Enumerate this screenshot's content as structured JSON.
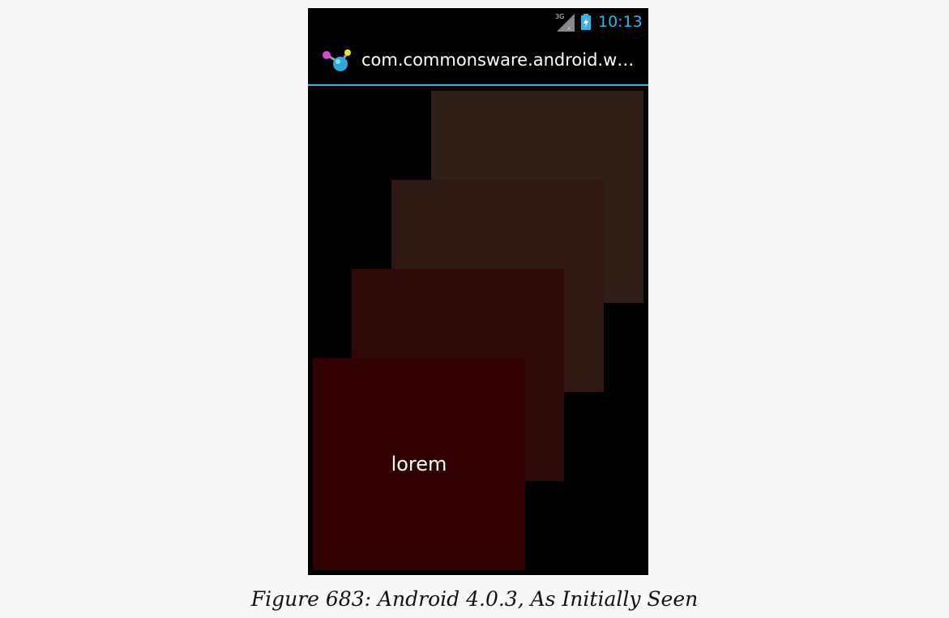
{
  "status_bar": {
    "network_label": "3G",
    "time": "10:13",
    "signal_icon": "signal-icon",
    "battery_icon": "battery-charging-icon",
    "accent_color": "#33b5e5"
  },
  "action_bar": {
    "app_icon": "molecule-app-icon",
    "title": "com.commonsware.android.w…",
    "underline_color": "#33b5e5"
  },
  "pages": [
    {
      "label": "lorem",
      "color": "#310101"
    },
    {
      "label": "",
      "color": "#300a09"
    },
    {
      "label": "",
      "color": "#2f1714"
    },
    {
      "label": "",
      "color": "#301e19"
    }
  ],
  "caption": "Figure 683: Android 4.0.3, As Initially Seen"
}
